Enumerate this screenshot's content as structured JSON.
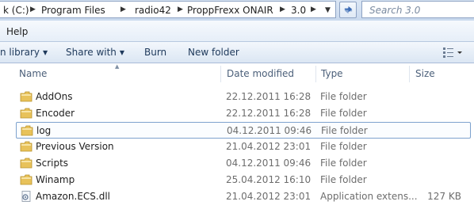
{
  "address": {
    "crumbs": [
      "k (C:)",
      "Program Files",
      "radio42",
      "ProppFrexx ONAIR",
      "3.0"
    ],
    "separator": "▶",
    "dropdown": "▼"
  },
  "search": {
    "placeholder": "Search 3.0"
  },
  "menu": {
    "help": "Help"
  },
  "toolbar": {
    "library": "n library",
    "share_with": "Share with",
    "burn": "Burn",
    "new_folder": "New folder"
  },
  "columns": {
    "name": "Name",
    "date": "Date modified",
    "type": "Type",
    "size": "Size"
  },
  "files": [
    {
      "name": "AddOns",
      "date": "22.12.2011 16:28",
      "type": "File folder",
      "size": "",
      "icon": "folder-icon"
    },
    {
      "name": "Encoder",
      "date": "22.12.2011 16:28",
      "type": "File folder",
      "size": "",
      "icon": "folder-icon"
    },
    {
      "name": "log",
      "date": "04.12.2011 09:46",
      "type": "File folder",
      "size": "",
      "icon": "folder-icon"
    },
    {
      "name": "Previous Version",
      "date": "21.04.2012 23:01",
      "type": "File folder",
      "size": "",
      "icon": "folder-icon"
    },
    {
      "name": "Scripts",
      "date": "04.12.2011 09:46",
      "type": "File folder",
      "size": "",
      "icon": "folder-icon"
    },
    {
      "name": "Winamp",
      "date": "25.04.2012 16:10",
      "type": "File folder",
      "size": "",
      "icon": "folder-icon"
    },
    {
      "name": "Amazon.ECS.dll",
      "date": "21.04.2012 23:01",
      "type": "Application extens...",
      "size": "127 KB",
      "icon": "dll-file-icon"
    }
  ],
  "colors": {
    "folder": "#e8c25a",
    "selection_border": "#7da2ce",
    "header_text": "#4c607a",
    "toolbar_text": "#1e395b"
  }
}
